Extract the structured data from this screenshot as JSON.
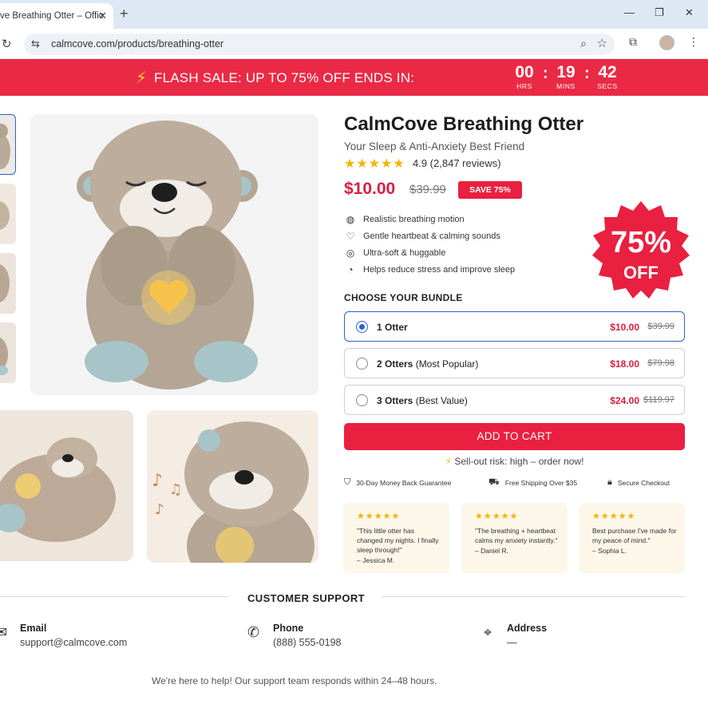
{
  "browser": {
    "tab_title": "ve Breathing Otter – Offic",
    "close_glyph": "✕",
    "new_tab_glyph": "+",
    "url": "calmcove.com/products/breathing-otter"
  },
  "flash": {
    "message": "FLASH SALE: UP TO 75% OFF ENDS IN:",
    "hours": "00",
    "hours_label": "HRS",
    "mins": "19",
    "mins_label": "MINS",
    "secs": "42",
    "secs_label": "SECS"
  },
  "product": {
    "title": "CalmCove Breathing Otter",
    "subtitle": "Your Sleep & Anti-Anxiety Best Friend",
    "stars": "★★★★★",
    "rating": "4.9 (2,847 reviews)",
    "price": "$10.00",
    "old_price": "$39.99",
    "save_badge": "SAVE 75%",
    "features": [
      {
        "icon": "breath-icon",
        "text": "Realistic breathing motion"
      },
      {
        "icon": "heart-icon",
        "text": "Gentle heartbeat & calming sounds"
      },
      {
        "icon": "softness-icon",
        "text": "Ultra-soft & huggable"
      },
      {
        "icon": "sleep-icon",
        "text": "Helps reduce stress and improve sleep"
      }
    ],
    "seal_percent": "75%",
    "seal_off": "OFF"
  },
  "bundle": {
    "heading": "CHOOSE YOUR BUNDLE",
    "options": [
      {
        "qty": "1 Otter",
        "note": "",
        "price": "$10.00",
        "old": "$39.99",
        "selected": true
      },
      {
        "qty": "2 Otters",
        "note": " (Most Popular)",
        "price": "$18.00",
        "old": "$79.98",
        "selected": false
      },
      {
        "qty": "3 Otters",
        "note": " (Best Value)",
        "price": "$24.00",
        "old": "$119.97",
        "selected": false
      }
    ]
  },
  "cart": {
    "button": "ADD TO CART",
    "sellout": "Sell-out risk: high – order now!"
  },
  "trust": [
    {
      "icon": "shield-check-icon",
      "text": "30-Day Money Back Guarantee"
    },
    {
      "icon": "truck-icon",
      "text": "Free Shipping Over $35"
    },
    {
      "icon": "lock-icon",
      "text": "Secure Checkout"
    }
  ],
  "reviews": [
    {
      "stars": "★★★★★",
      "text": "\"This little otter has changed my nights. I finally sleep through!\"",
      "author": "– Jessica M."
    },
    {
      "stars": "★★★★★",
      "text": "\"The breathing + heartbeat calms my anxiety instantly.\"",
      "author": "– Daniel R."
    },
    {
      "stars": "★★★★★",
      "text": "Best purchase I've made for my peace of mind.\"",
      "author": "– Sophia L."
    }
  ],
  "support": {
    "heading": "CUSTOMER SUPPORT",
    "email_label": "Email",
    "email_value": "support@calmcove.com",
    "phone_label": "Phone",
    "phone_value": "(888) 555-0198",
    "address_label": "Address",
    "address_value": "—",
    "footer": "We're here to help! Our support team responds within 24–48 hours."
  },
  "colors": {
    "accent_red": "#ea2a45",
    "price_red": "#d8203f",
    "select_blue": "#2b63c9",
    "star_gold": "#f5b400"
  }
}
